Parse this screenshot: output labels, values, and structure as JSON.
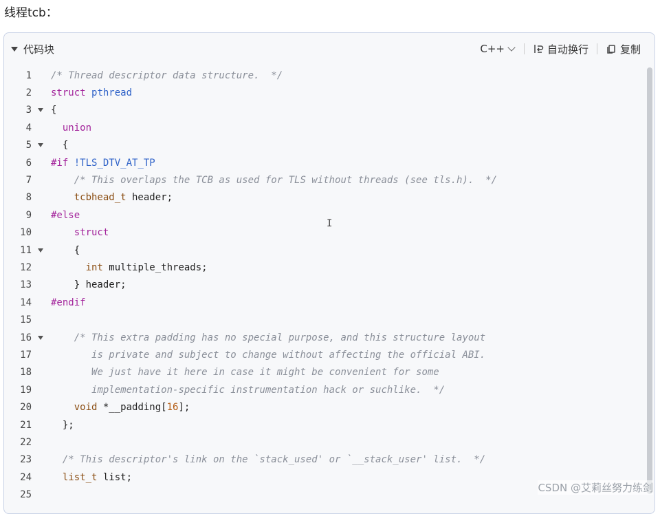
{
  "heading": "线程tcb：",
  "code_block": {
    "title": "代码块",
    "language": "C++",
    "wrap_label": "自动换行",
    "copy_label": "复制",
    "lines": [
      {
        "n": "1",
        "fold": false,
        "tokens": [
          [
            "c",
            "/* Thread descriptor data structure.  */"
          ]
        ]
      },
      {
        "n": "2",
        "fold": false,
        "tokens": [
          [
            "k",
            "struct"
          ],
          [
            "d",
            " "
          ],
          [
            "t",
            "pthread"
          ]
        ]
      },
      {
        "n": "3",
        "fold": true,
        "tokens": [
          [
            "d",
            "{"
          ]
        ]
      },
      {
        "n": "4",
        "fold": false,
        "tokens": [
          [
            "d",
            "  "
          ],
          [
            "k",
            "union"
          ]
        ]
      },
      {
        "n": "5",
        "fold": true,
        "tokens": [
          [
            "d",
            "  {"
          ]
        ]
      },
      {
        "n": "6",
        "fold": false,
        "tokens": [
          [
            "p",
            "#if"
          ],
          [
            "d",
            " "
          ],
          [
            "t",
            "!TLS_DTV_AT_TP"
          ]
        ]
      },
      {
        "n": "7",
        "fold": false,
        "tokens": [
          [
            "d",
            "    "
          ],
          [
            "c",
            "/* This overlaps the TCB as used for TLS without threads (see tls.h).  */"
          ]
        ]
      },
      {
        "n": "8",
        "fold": false,
        "tokens": [
          [
            "d",
            "    "
          ],
          [
            "ty",
            "tcbhead_t"
          ],
          [
            "d",
            " header;"
          ]
        ]
      },
      {
        "n": "9",
        "fold": false,
        "tokens": [
          [
            "p",
            "#else"
          ]
        ]
      },
      {
        "n": "10",
        "fold": false,
        "tokens": [
          [
            "d",
            "    "
          ],
          [
            "k",
            "struct"
          ]
        ]
      },
      {
        "n": "11",
        "fold": true,
        "tokens": [
          [
            "d",
            "    {"
          ]
        ]
      },
      {
        "n": "12",
        "fold": false,
        "tokens": [
          [
            "d",
            "      "
          ],
          [
            "ty",
            "int"
          ],
          [
            "d",
            " multiple_threads;"
          ]
        ]
      },
      {
        "n": "13",
        "fold": false,
        "tokens": [
          [
            "d",
            "    } header;"
          ]
        ]
      },
      {
        "n": "14",
        "fold": false,
        "tokens": [
          [
            "p",
            "#endif"
          ]
        ]
      },
      {
        "n": "15",
        "fold": false,
        "tokens": [
          [
            "d",
            ""
          ]
        ]
      },
      {
        "n": "16",
        "fold": true,
        "tokens": [
          [
            "d",
            "    "
          ],
          [
            "c",
            "/* This extra padding has no special purpose, and this structure layout"
          ]
        ]
      },
      {
        "n": "17",
        "fold": false,
        "tokens": [
          [
            "d",
            "       "
          ],
          [
            "c",
            "is private and subject to change without affecting the official ABI."
          ]
        ]
      },
      {
        "n": "18",
        "fold": false,
        "tokens": [
          [
            "d",
            "       "
          ],
          [
            "c",
            "We just have it here in case it might be convenient for some"
          ]
        ]
      },
      {
        "n": "19",
        "fold": false,
        "tokens": [
          [
            "d",
            "       "
          ],
          [
            "c",
            "implementation-specific instrumentation hack or suchlike.  */"
          ]
        ]
      },
      {
        "n": "20",
        "fold": false,
        "tokens": [
          [
            "d",
            "    "
          ],
          [
            "ty",
            "void"
          ],
          [
            "d",
            " *__padding["
          ],
          [
            "n",
            "16"
          ],
          [
            "d",
            "];"
          ]
        ]
      },
      {
        "n": "21",
        "fold": false,
        "tokens": [
          [
            "d",
            "  };"
          ]
        ]
      },
      {
        "n": "22",
        "fold": false,
        "tokens": [
          [
            "d",
            ""
          ]
        ]
      },
      {
        "n": "23",
        "fold": false,
        "tokens": [
          [
            "d",
            "  "
          ],
          [
            "c",
            "/* This descriptor's link on the `stack_used' or `__stack_user' list.  */"
          ]
        ]
      },
      {
        "n": "24",
        "fold": false,
        "tokens": [
          [
            "d",
            "  "
          ],
          [
            "ty",
            "list_t"
          ],
          [
            "d",
            " list;"
          ]
        ]
      },
      {
        "n": "25",
        "fold": false,
        "tokens": [
          [
            "d",
            ""
          ]
        ]
      }
    ]
  },
  "watermark": "CSDN @艾莉丝努力练剑",
  "icons": {
    "collapse": "triangle-down-icon",
    "lang": "chevron-down-icon",
    "wrap": "wrap-icon",
    "copy": "copy-icon"
  },
  "colors": {
    "comment": "#8a8f99",
    "keyword": "#a3249b",
    "type": "#2f62c8",
    "border": "#c8d2e6"
  }
}
